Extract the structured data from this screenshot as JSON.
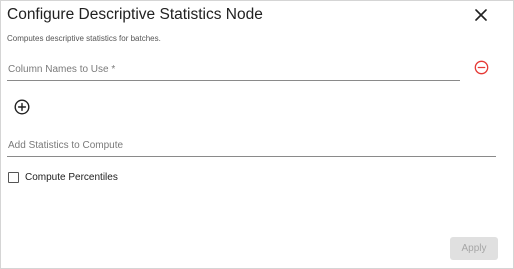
{
  "dialog": {
    "title": "Configure Descriptive Statistics Node",
    "subtitle": "Computes descriptive statistics for batches."
  },
  "fields": {
    "column_names": {
      "placeholder": "Column Names to Use *",
      "value": ""
    },
    "statistics": {
      "placeholder": "Add Statistics to Compute",
      "value": ""
    }
  },
  "checkbox": {
    "label": "Compute Percentiles",
    "checked": false
  },
  "actions": {
    "apply_label": "Apply"
  },
  "icons": {
    "close": "close-icon",
    "remove": "remove-circle-icon",
    "add": "add-circle-icon"
  },
  "colors": {
    "remove_icon": "#e53935",
    "apply_disabled_bg": "#e0e0e0",
    "apply_disabled_text": "#a6a6a6"
  }
}
